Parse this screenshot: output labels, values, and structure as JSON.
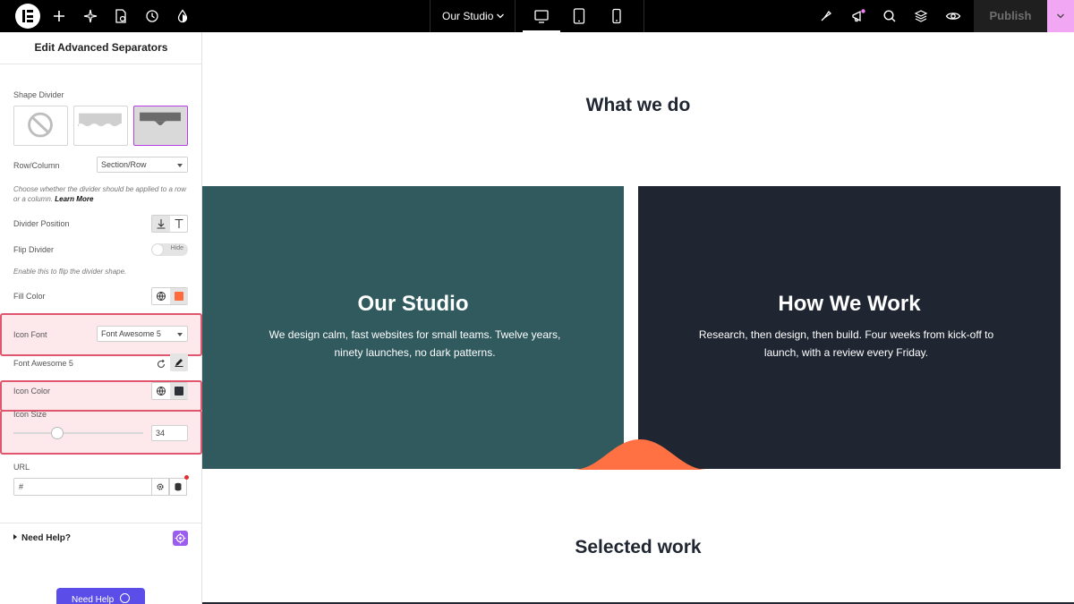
{
  "topbar": {
    "document_title": "Our Studio",
    "publish_label": "Publish",
    "icons": [
      "elementor-logo",
      "add-icon",
      "ai-sparkle-icon",
      "page-settings-icon",
      "history-icon",
      "theme-style-icon",
      "finder-icon",
      "whats-new-icon",
      "search-icon",
      "structure-icon",
      "preview-icon"
    ],
    "devices": [
      "desktop",
      "tablet",
      "mobile"
    ],
    "active_device": "desktop"
  },
  "panel": {
    "title": "Edit Advanced Separators",
    "shape_divider": {
      "label": "Shape Divider",
      "options": [
        "none",
        "waves",
        "mountain-block"
      ],
      "selected": "mountain-block"
    },
    "row_column": {
      "label": "Row/Column",
      "value": "Section/Row",
      "hint": "Choose whether the divider should be applied to a row or a column.",
      "learn_more": "Learn More"
    },
    "divider_position": {
      "label": "Divider Position",
      "selected": "bottom"
    },
    "flip_divider": {
      "label": "Flip Divider",
      "toggle_label": "Hide",
      "hint": "Enable this to flip the divider shape."
    },
    "fill_color": {
      "label": "Fill Color",
      "color": "#ff6b3d"
    },
    "icon_font": {
      "label": "Icon Font",
      "value": "Font Awesome 5"
    },
    "font_awesome": {
      "label": "Font Awesome 5"
    },
    "icon_color": {
      "label": "Icon Color",
      "color": "#2b3136"
    },
    "icon_size": {
      "label": "Icon Size",
      "value": "34"
    },
    "url": {
      "label": "URL",
      "value": "#"
    },
    "need_help": {
      "label": "Need Help?",
      "button_label": "Need Help"
    }
  },
  "canvas": {
    "section_title": "What we do",
    "cards": [
      {
        "title": "Our Studio",
        "text": "We design calm, fast websites for small teams. Twelve years, ninety launches, no dark patterns.",
        "bg": "#305a5e"
      },
      {
        "title": "How We Work",
        "text": "Research, then design, then build. Four weeks from kick-off to launch, with a review every Friday.",
        "bg": "#1f2631"
      }
    ],
    "divider_color": "#ff7043",
    "next_title": "Selected work"
  }
}
